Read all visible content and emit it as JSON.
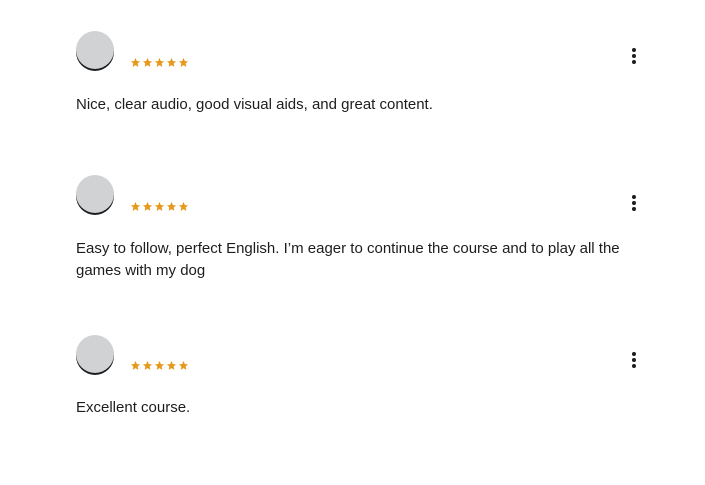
{
  "reviews": [
    {
      "rating": 5,
      "text": "Nice, clear audio, good visual aids, and great content.",
      "menu_icon": "more-vertical-icon"
    },
    {
      "rating": 5,
      "text": "Easy to follow, perfect English. I’m eager to continue the course and to play all the games with my dog",
      "menu_icon": "more-vertical-icon"
    },
    {
      "rating": 5,
      "text": "Excellent course.",
      "menu_icon": "more-vertical-icon"
    }
  ],
  "colors": {
    "star": "#e59819",
    "avatar": "#d1d2d3",
    "text": "#1c1d1f"
  }
}
